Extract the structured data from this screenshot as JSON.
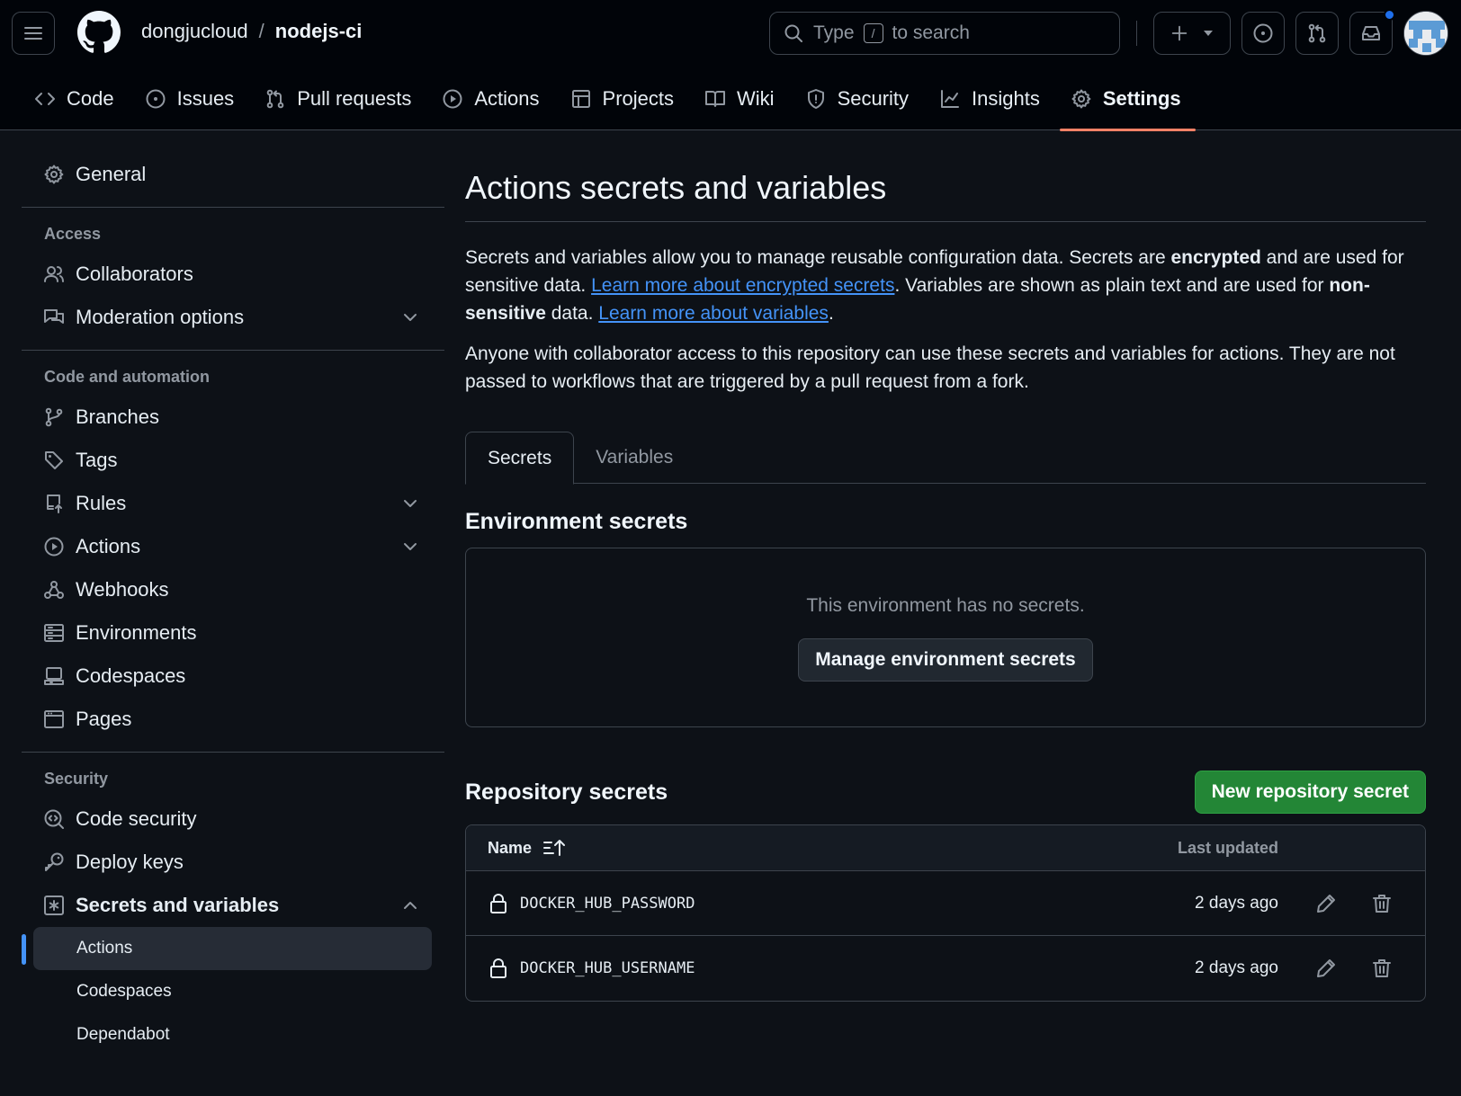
{
  "header": {
    "owner": "dongjucloud",
    "separator": "/",
    "repo": "nodejs-ci",
    "search_prefix": "Type",
    "search_key": "/",
    "search_suffix": "to search"
  },
  "repo_nav": [
    {
      "label": "Code",
      "icon": "code-icon"
    },
    {
      "label": "Issues",
      "icon": "issue-icon"
    },
    {
      "label": "Pull requests",
      "icon": "pull-request-icon"
    },
    {
      "label": "Actions",
      "icon": "play-icon"
    },
    {
      "label": "Projects",
      "icon": "table-icon"
    },
    {
      "label": "Wiki",
      "icon": "book-icon"
    },
    {
      "label": "Security",
      "icon": "shield-icon"
    },
    {
      "label": "Insights",
      "icon": "graph-icon"
    },
    {
      "label": "Settings",
      "icon": "gear-icon",
      "active": true
    }
  ],
  "sidebar": {
    "general": "General",
    "access_heading": "Access",
    "collaborators": "Collaborators",
    "moderation": "Moderation options",
    "code_heading": "Code and automation",
    "branches": "Branches",
    "tags": "Tags",
    "rules": "Rules",
    "actions": "Actions",
    "webhooks": "Webhooks",
    "environments": "Environments",
    "codespaces": "Codespaces",
    "pages": "Pages",
    "security_heading": "Security",
    "code_security": "Code security",
    "deploy_keys": "Deploy keys",
    "secrets_vars": "Secrets and variables",
    "sub_actions": "Actions",
    "sub_codespaces": "Codespaces",
    "sub_dependabot": "Dependabot"
  },
  "main": {
    "title": "Actions secrets and variables",
    "p1_a": "Secrets and variables allow you to manage reusable configuration data. Secrets are ",
    "p1_b": "encrypted",
    "p1_c": " and are used for sensitive data. ",
    "p1_link1": "Learn more about encrypted secrets",
    "p1_d": ". Variables are shown as plain text and are used for ",
    "p1_e": "non-sensitive",
    "p1_f": " data. ",
    "p1_link2": "Learn more about variables",
    "p1_g": ".",
    "p2": "Anyone with collaborator access to this repository can use these secrets and variables for actions. They are not passed to workflows that are triggered by a pull request from a fork.",
    "tab_secrets": "Secrets",
    "tab_variables": "Variables",
    "env_heading": "Environment secrets",
    "env_empty": "This environment has no secrets.",
    "env_button": "Manage environment secrets",
    "repo_heading": "Repository secrets",
    "new_button": "New repository secret",
    "col_name": "Name",
    "col_updated": "Last updated",
    "secrets": [
      {
        "name": "DOCKER_HUB_PASSWORD",
        "updated": "2 days ago"
      },
      {
        "name": "DOCKER_HUB_USERNAME",
        "updated": "2 days ago"
      }
    ]
  },
  "colors": {
    "accent_underline": "#f78166",
    "link": "#4493f8",
    "primary_button": "#238636",
    "notification_dot": "#1f6feb"
  }
}
